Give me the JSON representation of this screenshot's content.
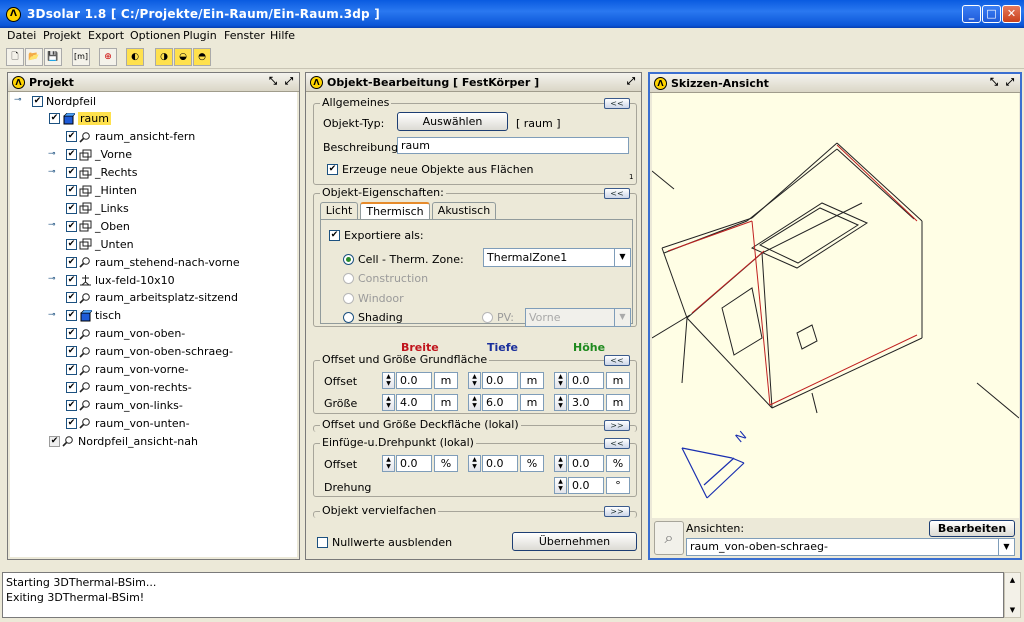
{
  "window": {
    "title": "3Dsolar 1.8  [ C:/Projekte/Ein-Raum/Ein-Raum.3dp ]",
    "app_icon": "3dsolar-logo"
  },
  "menu": [
    "Datei",
    "Projekt",
    "Export",
    "Optionen",
    "Plugin",
    "Fenster",
    "Hilfe"
  ],
  "toolbar": [
    {
      "icon": "new-file-icon",
      "label": ""
    },
    {
      "icon": "open-folder-icon",
      "label": ""
    },
    {
      "icon": "save-icon",
      "label": ""
    },
    {
      "icon": "m-bracket-icon",
      "label": "[m]"
    },
    {
      "icon": "lifebuoy-icon",
      "label": ""
    },
    {
      "icon": "plugin-a-icon",
      "label": ""
    },
    {
      "icon": "plugin-b-icon",
      "label": ""
    },
    {
      "icon": "plugin-c-icon",
      "label": ""
    },
    {
      "icon": "plugin-d-icon",
      "label": ""
    }
  ],
  "project": {
    "title": "Projekt",
    "tree": [
      {
        "label": "Nordpfeil",
        "level": 0,
        "checked": true,
        "icon": "none"
      },
      {
        "label": "raum",
        "level": 1,
        "checked": true,
        "icon": "cube-icon",
        "selected": true
      },
      {
        "label": "raum_ansicht-fern",
        "level": 2,
        "checked": true,
        "icon": "magnifier-icon"
      },
      {
        "label": "_Vorne",
        "level": 2,
        "checked": true,
        "icon": "planes-icon",
        "expander": true
      },
      {
        "label": "_Rechts",
        "level": 2,
        "checked": true,
        "icon": "planes-icon",
        "expander": true
      },
      {
        "label": "_Hinten",
        "level": 2,
        "checked": true,
        "icon": "planes-icon"
      },
      {
        "label": "_Links",
        "level": 2,
        "checked": true,
        "icon": "planes-icon"
      },
      {
        "label": "_Oben",
        "level": 2,
        "checked": true,
        "icon": "planes-icon",
        "expander": true
      },
      {
        "label": "_Unten",
        "level": 2,
        "checked": true,
        "icon": "planes-icon"
      },
      {
        "label": "raum_stehend-nach-vorne",
        "level": 2,
        "checked": true,
        "icon": "magnifier-icon"
      },
      {
        "label": "lux-feld-10x10",
        "level": 2,
        "checked": true,
        "icon": "grid-person-icon",
        "expander": true
      },
      {
        "label": "raum_arbeitsplatz-sitzend",
        "level": 2,
        "checked": true,
        "icon": "magnifier-icon"
      },
      {
        "label": "tisch",
        "level": 2,
        "checked": true,
        "icon": "cube-icon",
        "expander": true
      },
      {
        "label": "raum_von-oben-",
        "level": 2,
        "checked": true,
        "icon": "magnifier-icon"
      },
      {
        "label": "raum_von-oben-schraeg-",
        "level": 2,
        "checked": true,
        "icon": "magnifier-icon"
      },
      {
        "label": "raum_von-vorne-",
        "level": 2,
        "checked": true,
        "icon": "magnifier-icon"
      },
      {
        "label": "raum_von-rechts-",
        "level": 2,
        "checked": true,
        "icon": "magnifier-icon"
      },
      {
        "label": "raum_von-links-",
        "level": 2,
        "checked": true,
        "icon": "magnifier-icon"
      },
      {
        "label": "raum_von-unten-",
        "level": 2,
        "checked": true,
        "icon": "magnifier-icon"
      },
      {
        "label": "Nordpfeil_ansicht-nah",
        "level": 1,
        "checked": true,
        "icon": "magnifier-icon",
        "grey": true
      }
    ]
  },
  "edit": {
    "title": "Objekt-Bearbeitung  [ FestKörper ]",
    "general": {
      "legend": "Allgemeines",
      "type_label": "Objekt-Typ:",
      "select_button": "Auswählen",
      "type_value": "[ raum ]",
      "desc_label": "Beschreibung:",
      "desc_value": "raum",
      "create_from_faces": "Erzeuge neue Objekte aus Flächen",
      "create_from_faces_checked": true,
      "corner_number": "1"
    },
    "properties": {
      "legend": "Objekt-Eigenschaften:",
      "tabs": [
        "Licht",
        "Thermisch",
        "Akustisch"
      ],
      "active_tab": "Thermisch",
      "export_as": "Exportiere als:",
      "export_checked": true,
      "options": [
        {
          "label": "Cell - Therm. Zone:",
          "selected": true,
          "enabled": true
        },
        {
          "label": "Construction",
          "selected": false,
          "enabled": false
        },
        {
          "label": "Windoor",
          "selected": false,
          "enabled": false
        },
        {
          "label": "Shading",
          "selected": false,
          "enabled": true
        }
      ],
      "zone_value": "ThermalZone1",
      "pv_label": "PV:",
      "pv_value": "Vorne"
    },
    "dims": {
      "headers": [
        {
          "label": "Breite",
          "color": "#c0141c"
        },
        {
          "label": "Tiefe",
          "color": "#1a2f9c"
        },
        {
          "label": "Höhe",
          "color": "#1e8a1e"
        }
      ],
      "base_legend": "Offset und Größe Grundfläche",
      "offset_label": "Offset",
      "size_label": "Größe",
      "base_offset": [
        {
          "value": "0.0",
          "unit": "m"
        },
        {
          "value": "0.0",
          "unit": "m"
        },
        {
          "value": "0.0",
          "unit": "m"
        }
      ],
      "base_size": [
        {
          "value": "4.0",
          "unit": "m"
        },
        {
          "value": "6.0",
          "unit": "m"
        },
        {
          "value": "3.0",
          "unit": "m"
        }
      ],
      "top_legend": "Offset und Größe Deckfläche (lokal)",
      "pivot_legend": "Einfüge-u.Drehpunkt (lokal)",
      "pivot_offset_label": "Offset",
      "pivot_offset": [
        {
          "value": "0.0",
          "unit": "%"
        },
        {
          "value": "0.0",
          "unit": "%"
        },
        {
          "value": "0.0",
          "unit": "%"
        }
      ],
      "rotation_label": "Drehung",
      "rotation": {
        "value": "0.0",
        "unit": "°"
      },
      "multiply_legend": "Objekt vervielfachen",
      "collapse_label": "<<",
      "expand_label": ">>"
    },
    "hide_zero": "Nullwerte ausblenden",
    "hide_zero_checked": false,
    "apply_button": "Übernehmen"
  },
  "sketch": {
    "title": "Skizzen-Ansicht",
    "views_label": "Ansichten:",
    "edit_button": "Bearbeiten",
    "view_value": "raum_von-oben-schraeg-",
    "north_letter": "N",
    "bg_color": "#fffee5"
  },
  "log": {
    "lines": [
      "Starting 3DThermal-BSim...",
      "Exiting 3DThermal-BSim!"
    ]
  }
}
